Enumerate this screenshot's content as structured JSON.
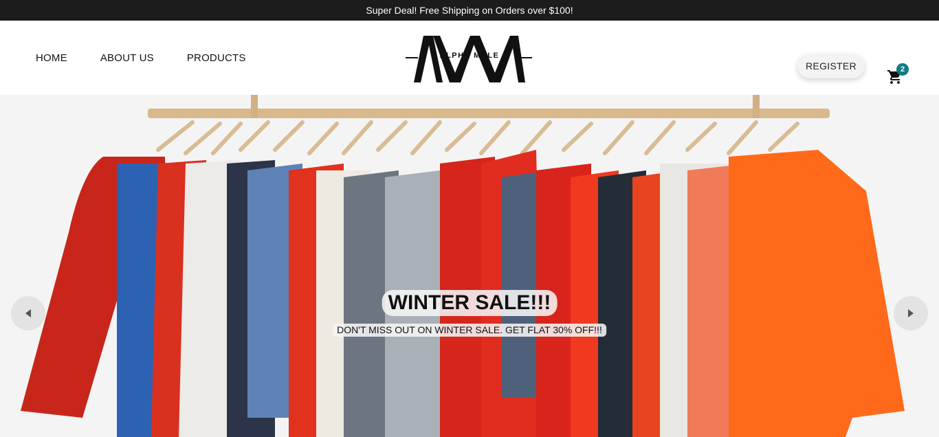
{
  "announcement": {
    "text": "Super Deal! Free Shipping on Orders over $100!"
  },
  "nav": {
    "items": [
      {
        "label": "HOME"
      },
      {
        "label": "ABOUT US"
      },
      {
        "label": "PRODUCTS"
      }
    ]
  },
  "logo": {
    "text": "ALPHA MALE"
  },
  "header": {
    "register_label": "REGISTER",
    "cart_count": "2",
    "cart_icon": "shopping-cart-icon"
  },
  "hero": {
    "title": "WINTER SALE!!!",
    "subtitle": "DON'T MISS OUT ON WINTER SALE. GET FLAT 30% OFF!!!",
    "prev_icon": "arrow-left-icon",
    "next_icon": "arrow-right-icon"
  },
  "colors": {
    "announcement_bg": "#1c1c1c",
    "badge": "#0e7c86",
    "hero_bg": "#f4f4f4"
  }
}
